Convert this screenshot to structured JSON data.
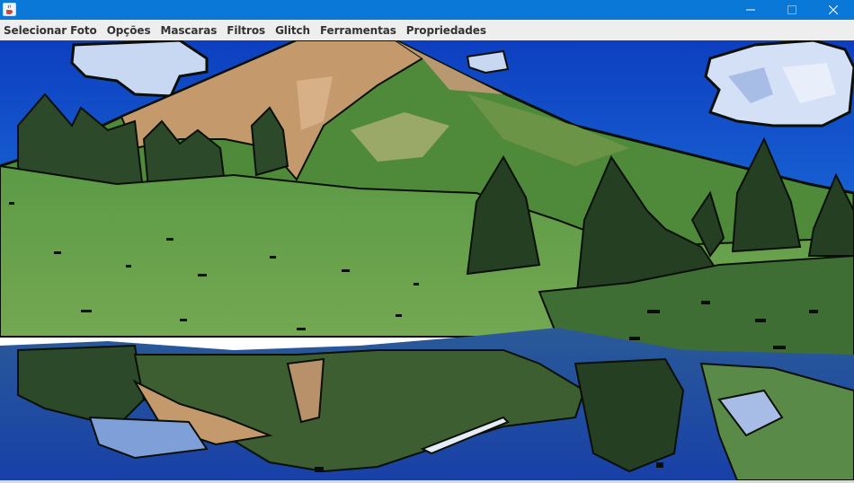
{
  "window": {
    "app_icon": "java-cup-icon",
    "controls": {
      "minimize_icon": "minimize-icon",
      "maximize_icon": "maximize-icon",
      "close_icon": "close-icon"
    }
  },
  "menu": {
    "items": [
      "Selecionar Foto",
      "Opções",
      "Mascaras",
      "Filtros",
      "Glitch",
      "Ferramentas",
      "Propriedades"
    ]
  },
  "image": {
    "description_icon": "photo-canvas",
    "colors": {
      "sky": "#1150c8",
      "grass": "#6aa04a",
      "mountain": "#c49a6c",
      "water": "#2a4f90",
      "outline": "#0a0f08"
    }
  }
}
